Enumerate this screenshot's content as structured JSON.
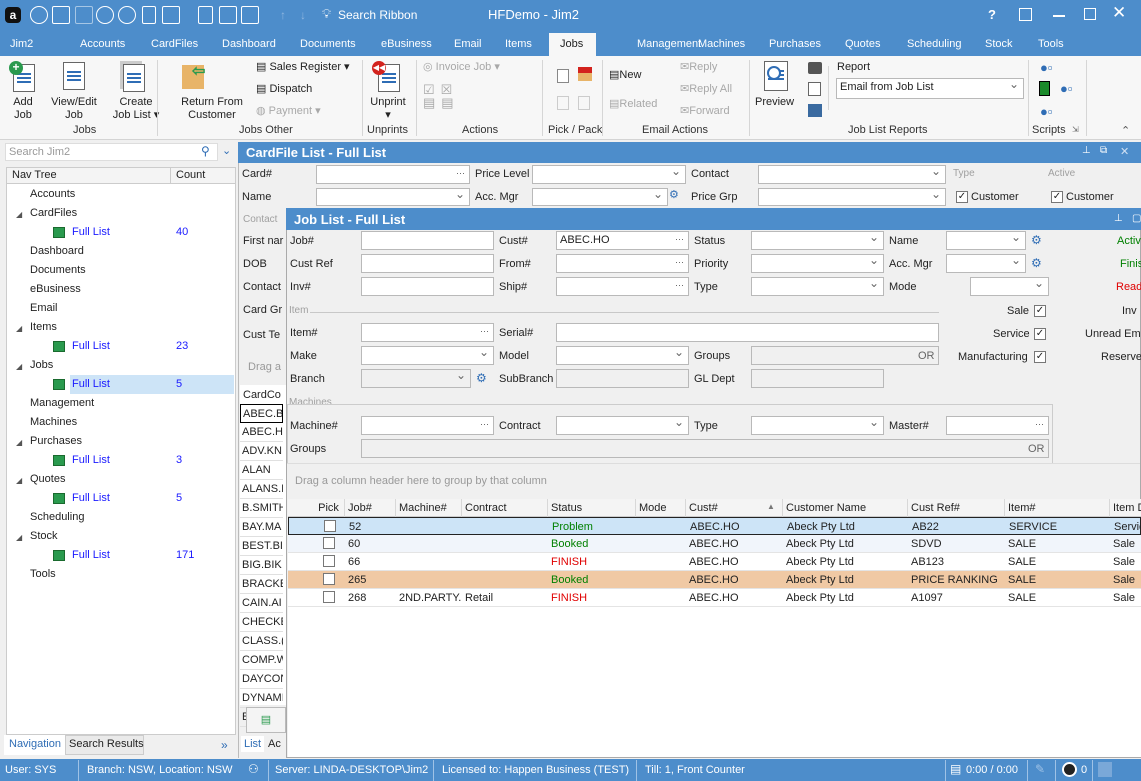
{
  "window": {
    "title": "HFDemo - Jim2",
    "search_ribbon": "Search Ribbon",
    "help": "?"
  },
  "colors": {
    "titlebar": "#4d8dcb",
    "selected_row": "#cde4f7",
    "highlight_row": "#f0c9a4",
    "status_green": "#008000",
    "status_red": "#e00000",
    "link_blue": "#1a1aff"
  },
  "menu_tabs": [
    "Jim2",
    "Accounts",
    "CardFiles",
    "Dashboard",
    "Documents",
    "eBusiness",
    "Email",
    "Items",
    "Jobs",
    "Management",
    "Machines",
    "Purchases",
    "Quotes",
    "Scheduling",
    "Stock",
    "Tools"
  ],
  "active_tab": "Jobs",
  "ribbon": {
    "add_job": [
      "Add",
      "Job"
    ],
    "view_edit_job": [
      "View/Edit",
      "Job"
    ],
    "create_job_list": [
      "Create",
      "Job List"
    ],
    "jobs_group": "Jobs",
    "return_from_customer": [
      "Return From",
      "Customer"
    ],
    "sales_register": "Sales Register",
    "dispatch": "Dispatch",
    "payment": "Payment",
    "jobs_other_group": "Jobs Other",
    "unprint": "Unprint",
    "unprints_group": "Unprints",
    "invoice_job": "Invoice Job",
    "actions_group": "Actions",
    "pick_pack_group": "Pick / Pack",
    "new": "New",
    "related": "Related",
    "reply": "Reply",
    "reply_all": "Reply All",
    "forward": "Forward",
    "email_actions_group": "Email Actions",
    "preview": "Preview",
    "report_label": "Report",
    "report_value": "Email from Job List",
    "job_list_reports_group": "Job List Reports",
    "scripts_group": "Scripts"
  },
  "nav": {
    "search_placeholder": "Search Jim2",
    "col_tree": "Nav Tree",
    "col_count": "Count",
    "items": [
      {
        "label": "Accounts",
        "level": 0
      },
      {
        "label": "CardFiles",
        "level": 0,
        "exp": true
      },
      {
        "label": "Full List",
        "level": 1,
        "count": "40"
      },
      {
        "label": "Dashboard",
        "level": 0
      },
      {
        "label": "Documents",
        "level": 0
      },
      {
        "label": "eBusiness",
        "level": 0
      },
      {
        "label": "Email",
        "level": 0
      },
      {
        "label": "Items",
        "level": 0,
        "exp": true
      },
      {
        "label": "Full List",
        "level": 1,
        "count": "23"
      },
      {
        "label": "Jobs",
        "level": 0,
        "exp": true
      },
      {
        "label": "Full List",
        "level": 1,
        "count": "5",
        "selected": true
      },
      {
        "label": "Management",
        "level": 0
      },
      {
        "label": "Machines",
        "level": 0
      },
      {
        "label": "Purchases",
        "level": 0,
        "exp": true
      },
      {
        "label": "Full List",
        "level": 1,
        "count": "3"
      },
      {
        "label": "Quotes",
        "level": 0,
        "exp": true
      },
      {
        "label": "Full List",
        "level": 1,
        "count": "5"
      },
      {
        "label": "Scheduling",
        "level": 0
      },
      {
        "label": "Stock",
        "level": 0,
        "exp": true
      },
      {
        "label": "Full List",
        "level": 1,
        "count": "171"
      },
      {
        "label": "Tools",
        "level": 0
      }
    ],
    "tab_navigation": "Navigation",
    "tab_search_results": "Search Results",
    "more": "»"
  },
  "cardfile": {
    "title": "CardFile List - Full List",
    "card_no": "Card#",
    "price_level": "Price Level",
    "contact": "Contact",
    "type_group": "Type",
    "active_group": "Active",
    "name": "Name",
    "acc_mgr": "Acc. Mgr",
    "price_grp": "Price Grp",
    "customer": "Customer",
    "customer2": "Customer",
    "contact_group": "Contact",
    "first_name": "First nar",
    "dob": "DOB",
    "contact2": "Contact",
    "card_grp": "Card Gr",
    "cust_te": "Cust Te",
    "drag": "Drag a",
    "col_code": "CardCo",
    "codes": [
      "ABEC.BI",
      "ABEC.H",
      "ADV.KN",
      "ALAN",
      "ALANS.I",
      "B.SMITH",
      "BAY.MA",
      "BEST.BI",
      "BIG.BIK",
      "BRACKE",
      "CAIN.AI",
      "CHECKE",
      "CLASS.(",
      "COMP.W",
      "DAYCON",
      "DYNAMI",
      "EJX.SYD"
    ],
    "tab_list": "List",
    "tab_ac": "Ac"
  },
  "joblist": {
    "title": "Job List - Full List",
    "job_no": "Job#",
    "cust_no": "Cust#",
    "cust_value": "ABEC.HO",
    "status": "Status",
    "name": "Name",
    "cust_ref": "Cust Ref",
    "from_no": "From#",
    "priority": "Priority",
    "acc_mgr": "Acc. Mgr",
    "inv_no": "Inv#",
    "ship_no": "Ship#",
    "type": "Type",
    "mode": "Mode",
    "item_group": "Item",
    "sale": "Sale",
    "service": "Service",
    "manufacturing": "Manufacturing",
    "item_no": "Item#",
    "serial_no": "Serial#",
    "make": "Make",
    "model": "Model",
    "groups": "Groups",
    "branch": "Branch",
    "subbranch": "SubBranch",
    "gl_dept": "GL Dept",
    "or": "OR",
    "machines_group": "Machines",
    "machine_no": "Machine#",
    "contract": "Contract",
    "type2": "Type",
    "master_no": "Master#",
    "groups2": "Groups",
    "or2": "OR",
    "right_labels": {
      "active": "Activ",
      "finish": "Finis",
      "ready": "Read",
      "inv": "Inv",
      "unread": "Unread Ema",
      "reserve": "Reserve"
    },
    "group_hint": "Drag a column header here to group by that column",
    "columns": [
      "Pick",
      "Job#",
      "Machine#",
      "Contract",
      "Status",
      "Mode",
      "Cust#",
      "Customer Name",
      "Cust Ref#",
      "Item#",
      "Item D"
    ],
    "sort_column": "Cust#",
    "rows": [
      {
        "job": "52",
        "machine": "",
        "contract": "",
        "status": "Problem",
        "status_color": "green",
        "mode": "",
        "cust": "ABEC.HO",
        "name": "Abeck Pty Ltd",
        "ref": "AB22",
        "item": "SERVICE",
        "desc": "Servic",
        "state": "selected"
      },
      {
        "job": "60",
        "machine": "",
        "contract": "",
        "status": "Booked",
        "status_color": "green",
        "mode": "",
        "cust": "ABEC.HO",
        "name": "Abeck Pty Ltd",
        "ref": "SDVD",
        "item": "SALE",
        "desc": "Sale",
        "state": "alt"
      },
      {
        "job": "66",
        "machine": "",
        "contract": "",
        "status": "FINISH",
        "status_color": "red",
        "mode": "",
        "cust": "ABEC.HO",
        "name": "Abeck Pty Ltd",
        "ref": "AB123",
        "item": "SALE",
        "desc": "Sale",
        "state": ""
      },
      {
        "job": "265",
        "machine": "",
        "contract": "",
        "status": "Booked",
        "status_color": "green",
        "mode": "",
        "cust": "ABEC.HO",
        "name": "Abeck Pty Ltd",
        "ref": "PRICE RANKING",
        "item": "SALE",
        "desc": "Sale",
        "state": "highlight"
      },
      {
        "job": "268",
        "machine": "2ND.PARTY.",
        "contract": "Retail",
        "status": "FINISH",
        "status_color": "red",
        "mode": "",
        "cust": "ABEC.HO",
        "name": "Abeck Pty Ltd",
        "ref": "A1097",
        "item": "SALE",
        "desc": "Sale",
        "state": ""
      }
    ]
  },
  "statusbar": {
    "user": "User: SYS",
    "branch": "Branch: NSW, Location: NSW",
    "server": "Server: LINDA-DESKTOP\\Jim2",
    "license": "Licensed to: Happen Business (TEST)",
    "till": "Till: 1, Front Counter",
    "time": "0:00 / 0:00",
    "clock_count": "0"
  }
}
